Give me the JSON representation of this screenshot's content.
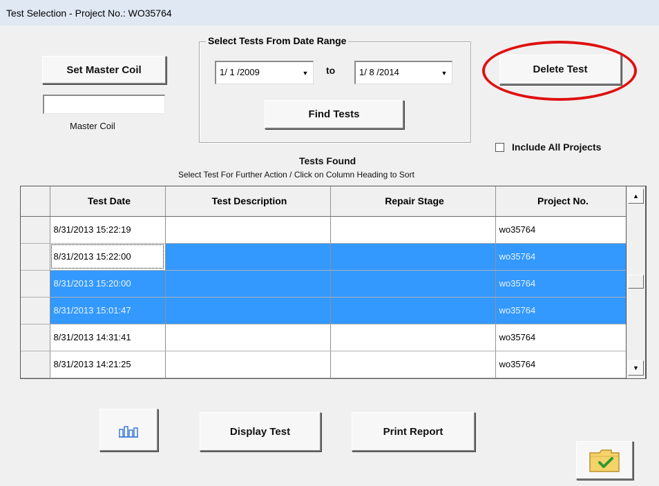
{
  "window": {
    "title": "Test Selection - Project No.: WO35764"
  },
  "master_coil": {
    "button_label": "Set Master Coil",
    "value": "",
    "label": "Master Coil"
  },
  "date_range": {
    "group_label": "Select Tests From Date Range",
    "from_value": "1/ 1 /2009",
    "to_label": "to",
    "to_value": "1/ 8 /2014",
    "find_label": "Find Tests"
  },
  "delete_button": {
    "label": "Delete Test",
    "highlight_color": "#e01010"
  },
  "include_all": {
    "label": "Include All Projects",
    "checked": false
  },
  "tests_found": {
    "title": "Tests Found",
    "subtitle": "Select Test For Further Action / Click on Column Heading to Sort",
    "columns": [
      "Test Date",
      "Test Description",
      "Repair Stage",
      "Project No."
    ],
    "rows": [
      {
        "date": "8/31/2013 15:22:19",
        "desc": "",
        "stage": "",
        "project": "wo35764",
        "selected": false,
        "focused": false
      },
      {
        "date": "8/31/2013 15:22:00",
        "desc": "",
        "stage": "",
        "project": "wo35764",
        "selected": true,
        "focused": true
      },
      {
        "date": "8/31/2013 15:20:00",
        "desc": "",
        "stage": "",
        "project": "wo35764",
        "selected": true,
        "focused": false
      },
      {
        "date": "8/31/2013 15:01:47",
        "desc": "",
        "stage": "",
        "project": "wo35764",
        "selected": true,
        "focused": false
      },
      {
        "date": "8/31/2013 14:31:41",
        "desc": "",
        "stage": "",
        "project": "wo35764",
        "selected": false,
        "focused": false
      },
      {
        "date": "8/31/2013 14:21:25",
        "desc": "",
        "stage": "",
        "project": "wo35764",
        "selected": false,
        "focused": false
      }
    ],
    "selection_color": "#3399ff"
  },
  "bottom": {
    "chart_icon": "bar-chart-icon",
    "display_label": "Display Test",
    "print_label": "Print Report",
    "ok_icon": "folder-check-icon"
  }
}
